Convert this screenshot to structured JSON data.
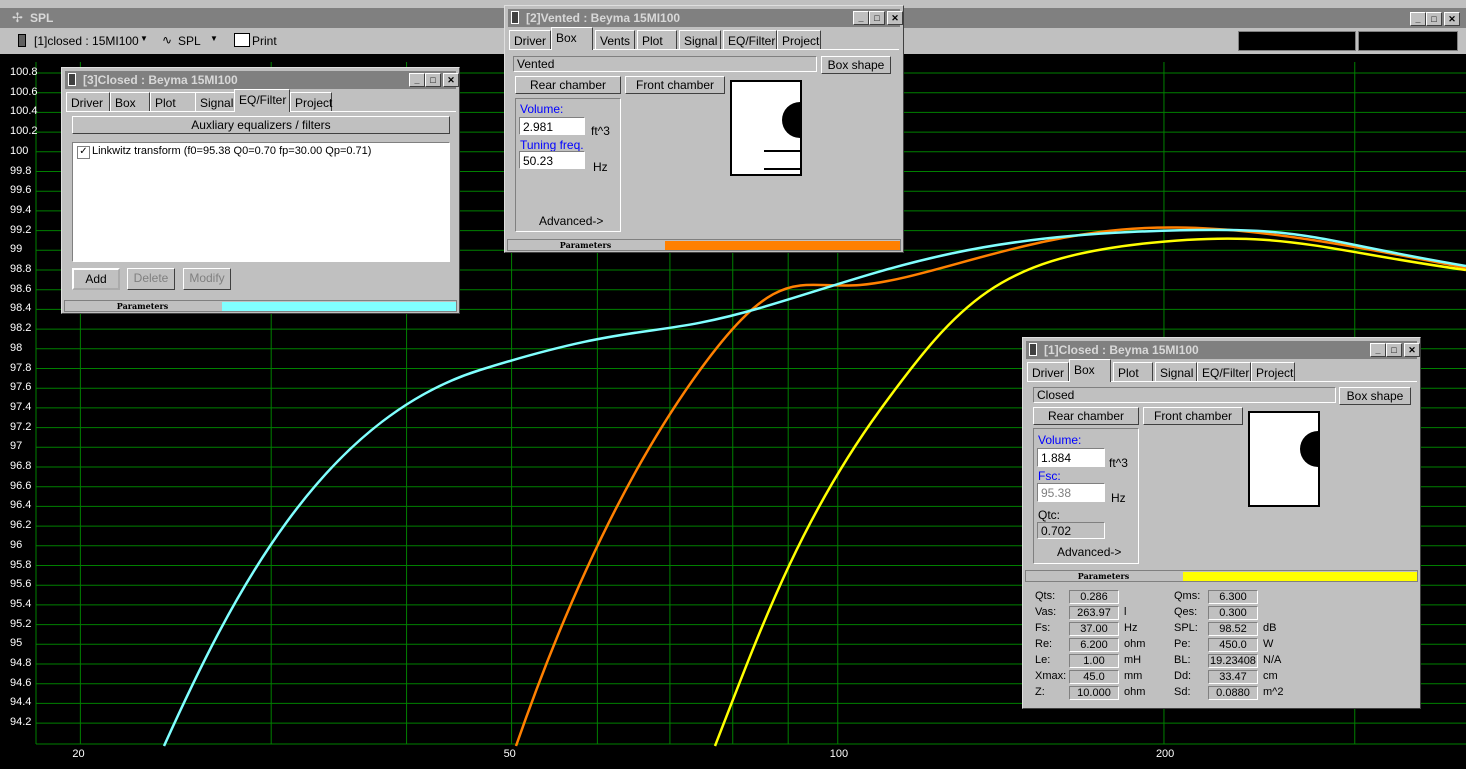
{
  "app": {
    "title": "SPL",
    "toolbar": {
      "project_select": "[1]closed : 15MI100",
      "view_select": "SPL",
      "print_label": "Print"
    }
  },
  "plot": {
    "y_ticks": [
      "100.8",
      "100.6",
      "100.4",
      "100.2",
      "100",
      "99.8",
      "99.6",
      "99.4",
      "99.2",
      "99",
      "98.8",
      "98.6",
      "98.4",
      "98.2",
      "98",
      "97.8",
      "97.6",
      "97.4",
      "97.2",
      "97",
      "96.8",
      "96.6",
      "96.4",
      "96.2",
      "96",
      "95.8",
      "95.6",
      "95.4",
      "95.2",
      "95",
      "94.8",
      "94.6",
      "94.4",
      "94.2"
    ],
    "x_ticks": [
      "20",
      "50",
      "100",
      "200"
    ],
    "colors": {
      "grid": "#008000",
      "cyan": "#80ffff",
      "orange": "#ff8000",
      "yellow": "#ffff00"
    }
  },
  "win3": {
    "title": "[3]Closed : Beyma 15MI100",
    "tabs": [
      "Driver",
      "Box",
      "Plot",
      "Signal",
      "EQ/Filter",
      "Project"
    ],
    "aux_button": "Auxliary equalizers / filters",
    "list_item": "Linkwitz transform (f0=95.38 Q0=0.70 fp=30.00 Qp=0.71)",
    "add": "Add",
    "delete": "Delete",
    "modify": "Modify",
    "status": "Parameters",
    "status_color": "#80ffff"
  },
  "win2": {
    "title": "[2]Vented : Beyma 15MI100",
    "tabs": [
      "Driver",
      "Box",
      "Vents",
      "Plot",
      "Signal",
      "EQ/Filter",
      "Project"
    ],
    "box_type": "Vented",
    "box_shape": "Box shape",
    "rear_chamber": "Rear chamber",
    "front_chamber": "Front chamber",
    "volume_label": "Volume:",
    "volume": "2.981",
    "volume_unit": "ft^3",
    "tuning_label": "Tuning freq.",
    "tuning": "50.23",
    "tuning_unit": "Hz",
    "advanced": "Advanced->",
    "status": "Parameters",
    "status_color": "#ff8000"
  },
  "win1": {
    "title": "[1]Closed : Beyma 15MI100",
    "tabs": [
      "Driver",
      "Box",
      "Plot",
      "Signal",
      "EQ/Filter",
      "Project"
    ],
    "box_type": "Closed",
    "box_shape": "Box shape",
    "rear_chamber": "Rear chamber",
    "front_chamber": "Front chamber",
    "volume_label": "Volume:",
    "volume": "1.884",
    "volume_unit": "ft^3",
    "fsc_label": "Fsc:",
    "fsc": "95.38",
    "fsc_unit": "Hz",
    "qtc_label": "Qtc:",
    "qtc": "0.702",
    "advanced": "Advanced->",
    "status": "Parameters",
    "status_color": "#ffff00",
    "params_left": [
      {
        "label": "Qts:",
        "value": "0.286",
        "unit": ""
      },
      {
        "label": "Vas:",
        "value": "263.97",
        "unit": "l"
      },
      {
        "label": "Fs:",
        "value": "37.00",
        "unit": "Hz"
      },
      {
        "label": "Re:",
        "value": "6.200",
        "unit": "ohm"
      },
      {
        "label": "Le:",
        "value": "1.00",
        "unit": "mH"
      },
      {
        "label": "Xmax:",
        "value": "45.0",
        "unit": "mm"
      },
      {
        "label": "Z:",
        "value": "10.000",
        "unit": "ohm"
      }
    ],
    "params_right": [
      {
        "label": "Qms:",
        "value": "6.300",
        "unit": ""
      },
      {
        "label": "Qes:",
        "value": "0.300",
        "unit": ""
      },
      {
        "label": "SPL:",
        "value": "98.52",
        "unit": "dB"
      },
      {
        "label": "Pe:",
        "value": "450.0",
        "unit": "W"
      },
      {
        "label": "BL:",
        "value": "19.23408",
        "unit": "N/A"
      },
      {
        "label": "Dd:",
        "value": "33.47",
        "unit": "cm"
      },
      {
        "label": "Sd:",
        "value": "0.0880",
        "unit": "m^2"
      }
    ]
  }
}
